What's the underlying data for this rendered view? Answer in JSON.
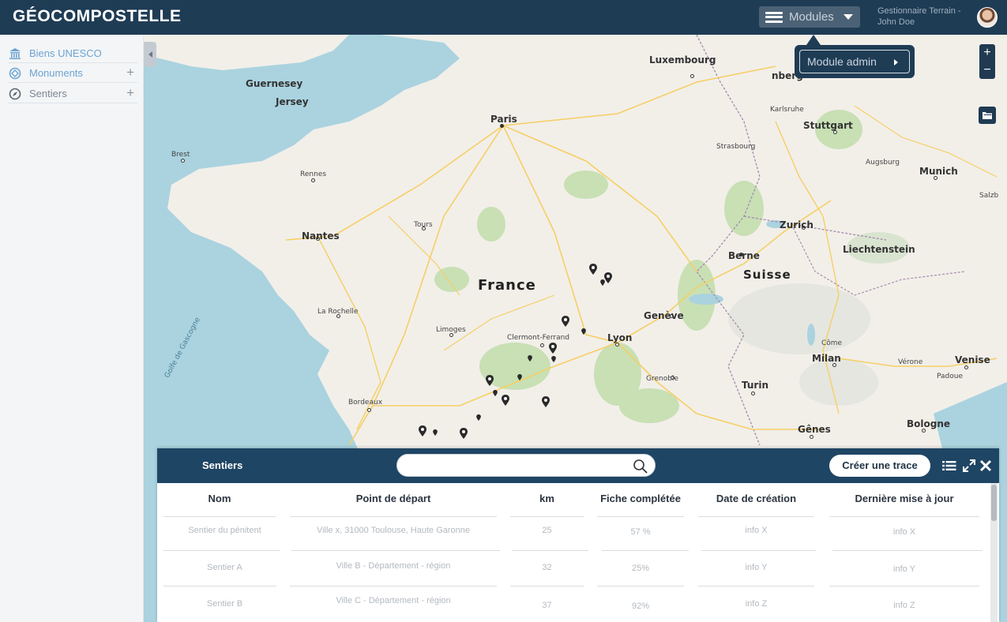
{
  "app": {
    "title": "GÉOCOMPOSTELLE"
  },
  "header": {
    "modules_label": "Modules",
    "user_line1": "Gestionnaire Terrain -",
    "user_line2": "John Doe",
    "popup_label": "Module admin"
  },
  "sidebar": {
    "items": [
      {
        "label": "Biens UNESCO",
        "icon": "museum-icon"
      },
      {
        "label": "Monuments",
        "icon": "monument-icon",
        "action": "+"
      },
      {
        "label": "Sentiers",
        "icon": "compass-icon",
        "action": "+"
      }
    ]
  },
  "map": {
    "zoom_in": "+",
    "zoom_out": "−",
    "labels": {
      "luxembourg": "Luxembourg",
      "guernesey": "Guernesey",
      "jersey": "Jersey",
      "paris": "Paris",
      "brest": "Brest",
      "rennes": "Rennes",
      "nantes": "Nantes",
      "tours": "Tours",
      "france": "France",
      "larochelle": "La Rochelle",
      "limoges": "Limoges",
      "clermont": "Clermont-Ferrand",
      "lyon": "Lyon",
      "bordeaux": "Bordeaux",
      "golfe": "Golfe de Gascogne",
      "karlsruhe": "Karlsruhe",
      "stuttgart": "Stuttgart",
      "strasbourg": "Strasbourg",
      "augsburg": "Augsburg",
      "munich": "Munich",
      "salzb": "Salzb",
      "zurich": "Zurich",
      "liechtenstein": "Liechtenstein",
      "berne": "Berne",
      "suisse": "Suisse",
      "geneve": "Genève",
      "come": "Côme",
      "milan": "Milan",
      "verone": "Vérone",
      "venise": "Venise",
      "padoue": "Padoue",
      "grenoble": "Grenoble",
      "turin": "Turin",
      "genes": "Gênes",
      "bologne": "Bologne",
      "nberg": "nberg"
    }
  },
  "panel": {
    "title": "Sentiers",
    "search_placeholder": "",
    "create_label": "Créer une trace",
    "columns": [
      "Nom",
      "Point de départ",
      "km",
      "Fiche complétée",
      "Date de création",
      "Dernière mise à jour"
    ],
    "rows": [
      [
        "Sentier du pénitent",
        "Ville x, 31000 Toulouse, Haute Garonne",
        "25",
        "57 %",
        "info X",
        "info X"
      ],
      [
        "Sentier A",
        "Ville B - Département - région",
        "32",
        "25%",
        "info Y",
        "info Y"
      ],
      [
        "Sentier B",
        "Ville C - Département - région",
        "37",
        "92%",
        "info Z",
        "info Z"
      ]
    ]
  },
  "colors": {
    "header_bg": "#1f3c55",
    "panel_header_bg": "#1f4564",
    "sidebar_active": "#6ea3d1",
    "map_water": "#aad3df",
    "map_land": "#f2efe9"
  }
}
